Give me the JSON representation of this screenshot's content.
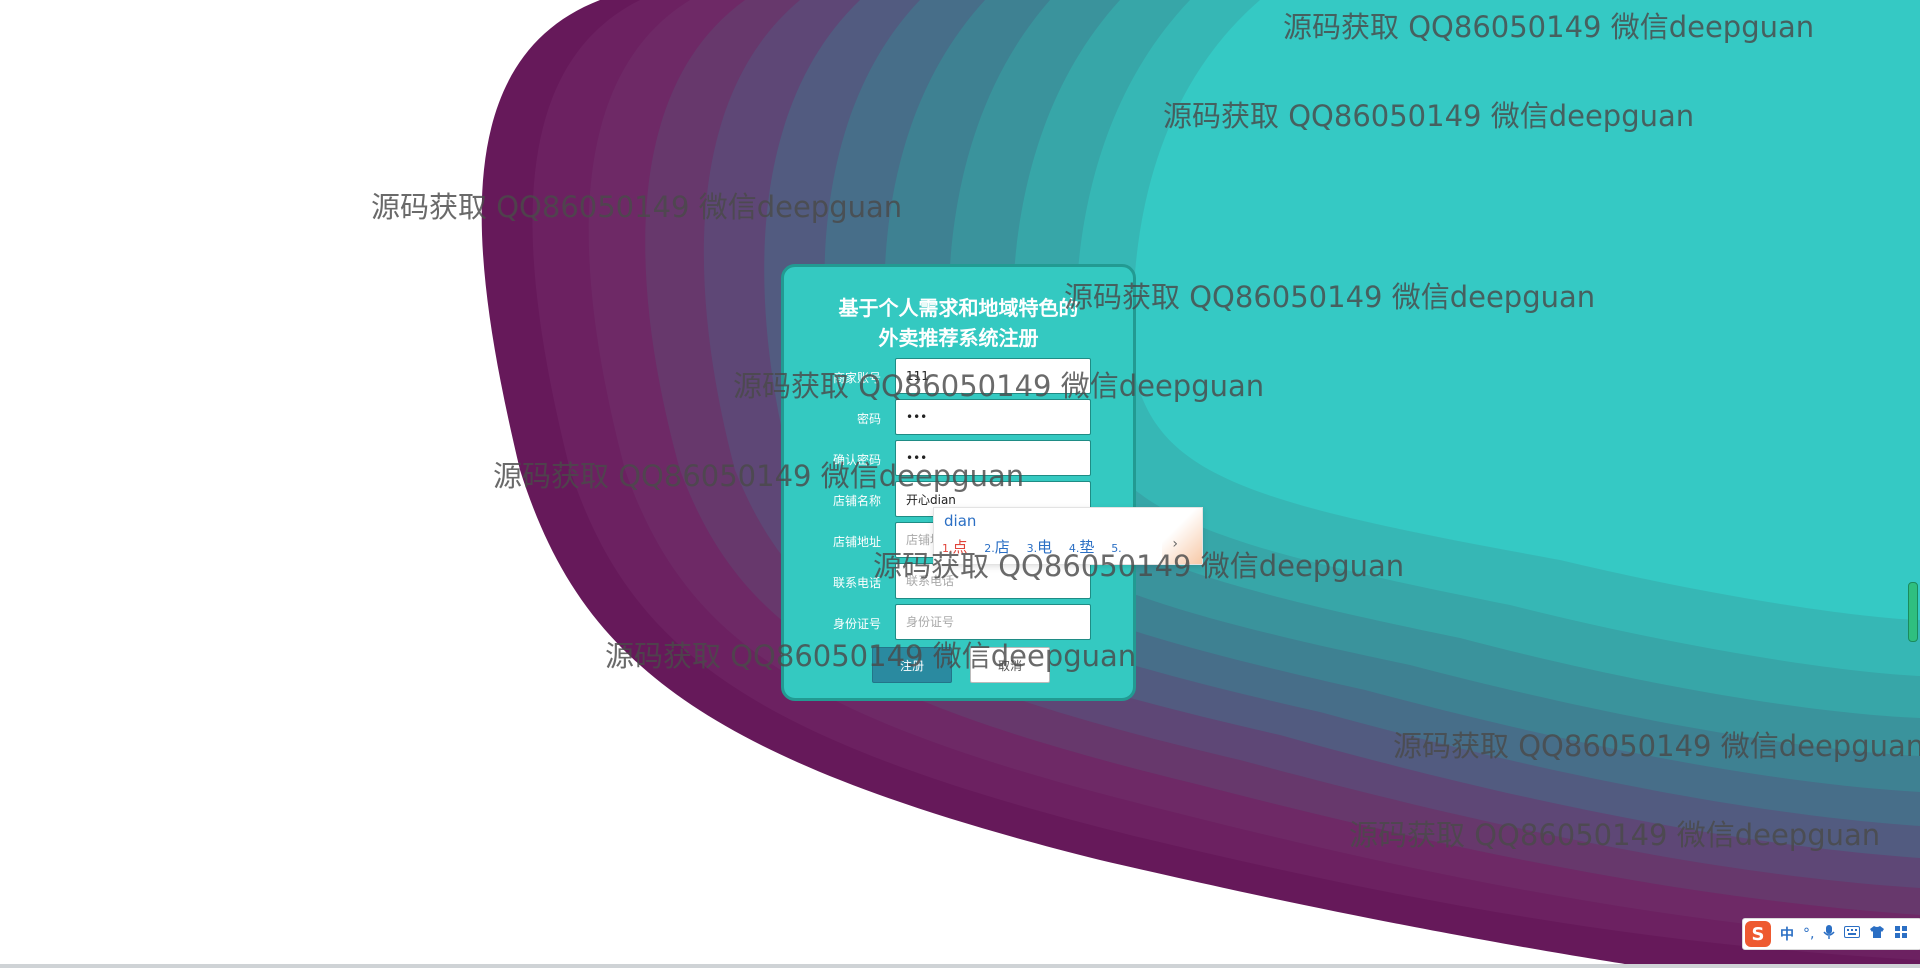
{
  "form": {
    "title_line1": "基于个人需求和地域特色的",
    "title_line2": "外卖推荐系统注册",
    "fields": [
      {
        "label": "商家账号",
        "value": "111",
        "placeholder": ""
      },
      {
        "label": "密码",
        "value": "•••",
        "placeholder": ""
      },
      {
        "label": "确认密码",
        "value": "•••",
        "placeholder": ""
      },
      {
        "label": "店铺名称",
        "value": "开心dian",
        "placeholder": ""
      },
      {
        "label": "店铺地址",
        "value": "",
        "placeholder": "店铺地址"
      },
      {
        "label": "联系电话",
        "value": "",
        "placeholder": "联系电话"
      },
      {
        "label": "身份证号",
        "value": "",
        "placeholder": "身份证号"
      }
    ],
    "register_label": "注册",
    "cancel_label": "取消"
  },
  "ime_popup": {
    "composition": "dian",
    "candidates": [
      {
        "index": "1.",
        "text": "点"
      },
      {
        "index": "2.",
        "text": "店"
      },
      {
        "index": "3.",
        "text": "电"
      },
      {
        "index": "4.",
        "text": "垫"
      },
      {
        "index": "5.",
        "text": ""
      }
    ],
    "next": "›"
  },
  "watermark_text": "源码获取 QQ86050149 微信deepguan",
  "ime_toolbar": {
    "logo": "S",
    "mode": "中",
    "items": [
      "°,",
      "mic-icon",
      "keyboard-icon",
      "shirt-icon",
      "grid-icon"
    ]
  },
  "colors": {
    "card_bg": "#34c9c1",
    "card_border": "#229a92",
    "primary_button": "#2a8aa0",
    "bg_outer": "#6a1a5e",
    "bg_inner": "#35c9c4"
  }
}
